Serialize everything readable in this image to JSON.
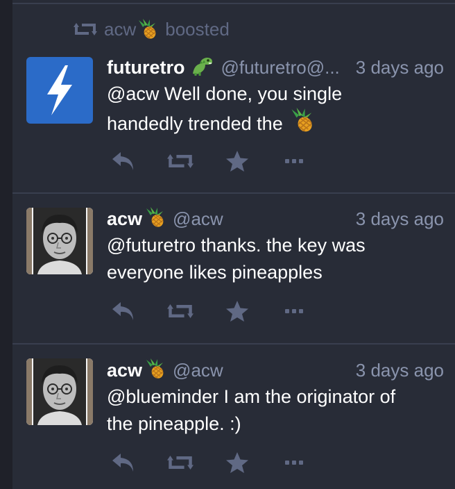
{
  "boost_banner": {
    "icon": "boost-icon",
    "user": "acw",
    "user_emoji": "pineapple",
    "label": "boosted"
  },
  "statuses": [
    {
      "avatar": "lightning-bolt-avatar",
      "display_name": "futuretro",
      "name_emoji": "dinosaur",
      "handle": "@futuretro@...",
      "time": "3 days ago",
      "text_line1": "@acw Well done, you single",
      "text_line2": "handedly trended the",
      "trailing_emoji": "pineapple"
    },
    {
      "avatar": "photo-avatar",
      "display_name": "acw",
      "name_emoji": "pineapple",
      "handle": "@acw",
      "time": "3 days ago",
      "text_line1": "@futuretro thanks. the key was",
      "text_line2": "everyone likes pineapples"
    },
    {
      "avatar": "photo-avatar",
      "display_name": "acw",
      "name_emoji": "pineapple",
      "handle": "@acw",
      "time": "3 days ago",
      "text_line1": "@blueminder I am the originator of",
      "text_line2": "the pineapple. :)"
    }
  ],
  "action_icons": [
    "reply-icon",
    "boost-icon",
    "favourite-icon",
    "more-icon"
  ],
  "colors": {
    "background": "#282c37",
    "muted": "#606984",
    "secondary_text": "#8a94ad",
    "divider": "#393f4f",
    "avatar_blue": "#2b6bc8"
  }
}
